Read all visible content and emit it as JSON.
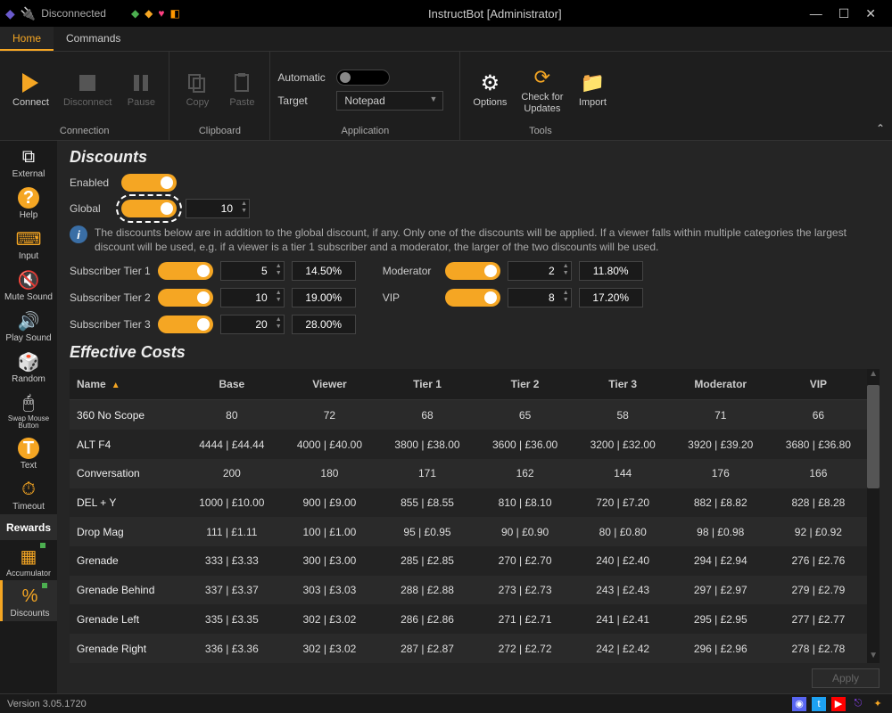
{
  "window": {
    "title": "InstructBot [Administrator]",
    "disconnected_label": "Disconnected"
  },
  "tabs": {
    "home": "Home",
    "commands": "Commands"
  },
  "ribbon": {
    "connection": {
      "connect": "Connect",
      "disconnect": "Disconnect",
      "pause": "Pause",
      "group": "Connection"
    },
    "clipboard": {
      "copy": "Copy",
      "paste": "Paste",
      "group": "Clipboard"
    },
    "application": {
      "automatic": "Automatic",
      "target": "Target",
      "target_value": "Notepad",
      "group": "Application"
    },
    "tools": {
      "options": "Options",
      "check": "Check for\nUpdates",
      "import": "Import",
      "group": "Tools"
    }
  },
  "sidebar": {
    "items": [
      {
        "label": "External"
      },
      {
        "label": "Help"
      },
      {
        "label": "Input"
      },
      {
        "label": "Mute Sound"
      },
      {
        "label": "Play Sound"
      },
      {
        "label": "Random"
      },
      {
        "label": "Swap Mouse Button"
      },
      {
        "label": "Text"
      },
      {
        "label": "Timeout"
      },
      {
        "label": "Rewards"
      },
      {
        "label": "Accumulator"
      },
      {
        "label": "Discounts"
      }
    ]
  },
  "discounts": {
    "title": "Discounts",
    "enabled_label": "Enabled",
    "global_label": "Global",
    "global_value": "10",
    "info": "The discounts below are in addition to the global discount, if any. Only one of the discounts will be applied. If a viewer falls within multiple categories the largest discount will be used, e.g. if a viewer is a tier 1 subscriber and a moderator, the larger of the two discounts will be used.",
    "tier1_label": "Subscriber Tier 1",
    "tier1_val": "5",
    "tier1_pct": "14.50%",
    "tier2_label": "Subscriber Tier 2",
    "tier2_val": "10",
    "tier2_pct": "19.00%",
    "tier3_label": "Subscriber Tier 3",
    "tier3_val": "20",
    "tier3_pct": "28.00%",
    "mod_label": "Moderator",
    "mod_val": "2",
    "mod_pct": "11.80%",
    "vip_label": "VIP",
    "vip_val": "8",
    "vip_pct": "17.20%"
  },
  "costs": {
    "title": "Effective Costs",
    "headers": {
      "name": "Name",
      "base": "Base",
      "viewer": "Viewer",
      "t1": "Tier 1",
      "t2": "Tier 2",
      "t3": "Tier 3",
      "mod": "Moderator",
      "vip": "VIP"
    },
    "rows": [
      {
        "name": "360 No Scope",
        "base": "80",
        "viewer": "72",
        "t1": "68",
        "t2": "65",
        "t3": "58",
        "mod": "71",
        "vip": "66"
      },
      {
        "name": "ALT F4",
        "base": "4444 | £44.44",
        "viewer": "4000 | £40.00",
        "t1": "3800 | £38.00",
        "t2": "3600 | £36.00",
        "t3": "3200 | £32.00",
        "mod": "3920 | £39.20",
        "vip": "3680 | £36.80"
      },
      {
        "name": "Conversation",
        "base": "200",
        "viewer": "180",
        "t1": "171",
        "t2": "162",
        "t3": "144",
        "mod": "176",
        "vip": "166"
      },
      {
        "name": "DEL + Y",
        "base": "1000 | £10.00",
        "viewer": "900 | £9.00",
        "t1": "855 | £8.55",
        "t2": "810 | £8.10",
        "t3": "720 | £7.20",
        "mod": "882 | £8.82",
        "vip": "828 | £8.28"
      },
      {
        "name": "Drop Mag",
        "base": "111 | £1.11",
        "viewer": "100 | £1.00",
        "t1": "95 | £0.95",
        "t2": "90 | £0.90",
        "t3": "80 | £0.80",
        "mod": "98 | £0.98",
        "vip": "92 | £0.92"
      },
      {
        "name": "Grenade",
        "base": "333 | £3.33",
        "viewer": "300 | £3.00",
        "t1": "285 | £2.85",
        "t2": "270 | £2.70",
        "t3": "240 | £2.40",
        "mod": "294 | £2.94",
        "vip": "276 | £2.76"
      },
      {
        "name": "Grenade Behind",
        "base": "337 | £3.37",
        "viewer": "303 | £3.03",
        "t1": "288 | £2.88",
        "t2": "273 | £2.73",
        "t3": "243 | £2.43",
        "mod": "297 | £2.97",
        "vip": "279 | £2.79"
      },
      {
        "name": "Grenade Left",
        "base": "335 | £3.35",
        "viewer": "302 | £3.02",
        "t1": "286 | £2.86",
        "t2": "271 | £2.71",
        "t3": "241 | £2.41",
        "mod": "295 | £2.95",
        "vip": "277 | £2.77"
      },
      {
        "name": "Grenade Right",
        "base": "336 | £3.36",
        "viewer": "302 | £3.02",
        "t1": "287 | £2.87",
        "t2": "272 | £2.72",
        "t3": "242 | £2.42",
        "mod": "296 | £2.96",
        "vip": "278 | £2.78"
      }
    ]
  },
  "footer": {
    "apply": "Apply",
    "version": "Version 3.05.1720"
  }
}
